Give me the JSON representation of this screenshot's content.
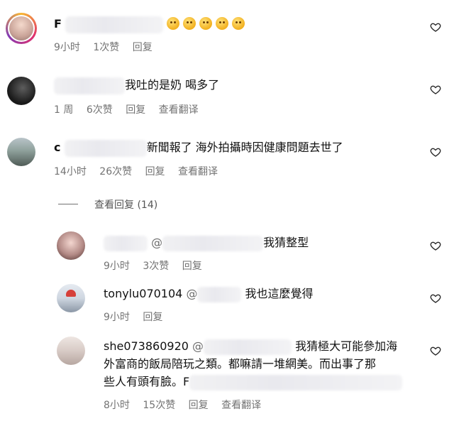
{
  "comments": [
    {
      "author": "F",
      "text": "",
      "time": "9小时",
      "likes": "1次赞",
      "reply": "回复"
    },
    {
      "text": "我吐的是奶 喝多了",
      "time": "1 周",
      "likes": "6次赞",
      "reply": "回复",
      "translate": "查看翻译"
    },
    {
      "author": "c",
      "text": "新聞報了 海外拍攝時因健康問題去世了",
      "time": "14小时",
      "likes": "26次赞",
      "reply": "回复",
      "translate": "查看翻译"
    }
  ],
  "view_replies": "查看回复 (14)",
  "replies": [
    {
      "mention": "@",
      "text": "我猜整型",
      "time": "9小时",
      "likes": "3次赞",
      "reply": "回复"
    },
    {
      "username": "tonylu070104",
      "mention": "@",
      "text": "我也這麼覺得",
      "time": "9小时",
      "reply": "回复"
    },
    {
      "username": "she073860920",
      "mention": "@",
      "text_line1": "我猜極大可能參加海",
      "text_line2": "外富商的飯局陪玩之類。都嘛請一堆網美。而出事了那",
      "text_line3": "些人有頭有臉。F",
      "time": "8小时",
      "likes": "15次赞",
      "reply": "回复",
      "translate": "查看翻译"
    }
  ],
  "icons": {
    "like": "heart-outline-icon",
    "emoji": "sad-face-emoji-icon"
  }
}
